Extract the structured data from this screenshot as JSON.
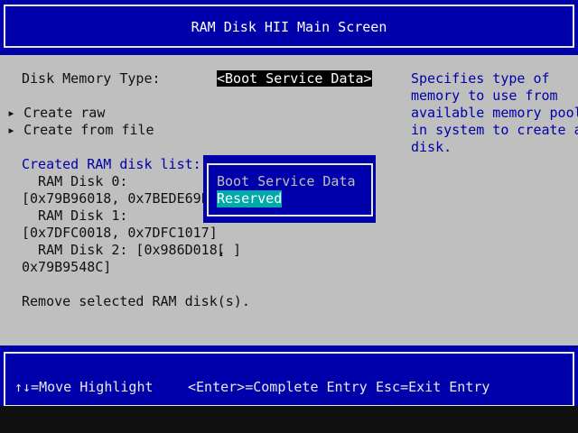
{
  "title": "RAM Disk HII Main Screen",
  "form": {
    "disk_memory_type_label": "Disk Memory Type:",
    "disk_memory_type_value": "<Boot Service Data>",
    "create_raw": "Create raw",
    "create_from_file": "Create from file",
    "created_list_label": "Created RAM disk list:",
    "ram_disks": [
      {
        "name_line": "  RAM Disk 0:",
        "range_line": "[0x79B96018, 0x7BEDE69E]"
      },
      {
        "name_line": "  RAM Disk 1:",
        "range_line": "[0x7DFC0018, 0x7DFC1017]"
      },
      {
        "name_line": "  RAM Disk 2: [0x986D018,",
        "checkbox": "[ ]",
        "range_line": "0x79B9548C]"
      }
    ],
    "remove_label": "Remove selected RAM disk(s)."
  },
  "help": {
    "lines": [
      "Specifies type of",
      "memory to use from",
      "available memory pool",
      "in system to create a",
      "disk."
    ]
  },
  "popup": {
    "options": [
      "Boot Service Data",
      "Reserved"
    ],
    "selected_index": 1
  },
  "footer": {
    "move_highlight": "↑↓=Move Highlight",
    "complete_entry": "<Enter>=Complete Entry",
    "exit_entry": "Esc=Exit Entry"
  },
  "colors": {
    "background": "#bfbfbf",
    "header_blue": "#0000aa",
    "help_text": "#0000aa",
    "selection_cyan": "#00aaaa"
  }
}
